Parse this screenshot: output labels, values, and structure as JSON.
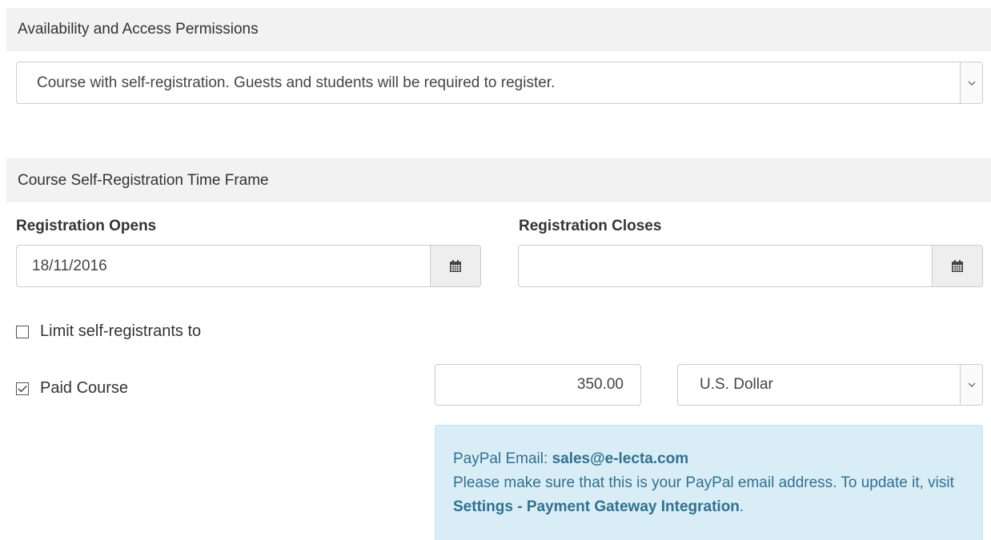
{
  "availability": {
    "heading": "Availability and Access Permissions",
    "selected": "Course with self-registration. Guests and students will be required to register."
  },
  "timeframe": {
    "heading": "Course Self-Registration Time Frame",
    "opens_label": "Registration Opens",
    "opens_value": "18/11/2016",
    "closes_label": "Registration Closes",
    "closes_value": ""
  },
  "limit": {
    "label": "Limit self-registrants to",
    "checked": false
  },
  "paid": {
    "label": "Paid Course",
    "checked": true,
    "price": "350.00",
    "currency": "U.S. Dollar"
  },
  "paypal": {
    "email_label": "PayPal Email:",
    "email": "sales@e-lecta.com",
    "note_prefix": "Please make sure that this is your PayPal email address. To update it, visit",
    "link_text": "Settings - Payment Gateway Integration",
    "note_suffix": "."
  },
  "icons": {
    "calendar": "calendar-icon",
    "dropdown": "chevron-down-icon",
    "check": "checkmark-icon"
  },
  "colors": {
    "section_bg": "#f2f2f2",
    "info_bg": "#d9edf7",
    "info_text": "#31708f"
  }
}
